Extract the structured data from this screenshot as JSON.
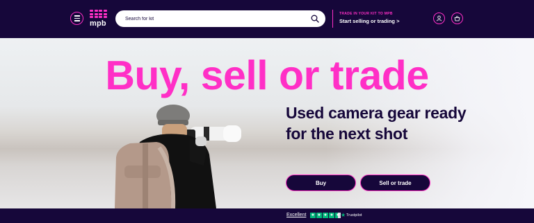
{
  "header": {
    "logo_text": "mpb",
    "search_placeholder": "Search for kit",
    "trade_eyebrow": "TRADE IN YOUR KIT TO MPB",
    "trade_link": "Start selling or trading >"
  },
  "hero": {
    "headline": "Buy, sell or trade",
    "subheadline": "Used camera gear ready for the next shot",
    "buttons": {
      "buy": "Buy",
      "sell": "Sell or trade"
    }
  },
  "trust": {
    "rating_label": "Excellent",
    "stars": 4.5,
    "brand": "Trustpilot"
  },
  "colors": {
    "brand_navy": "#16073a",
    "brand_pink": "#ff2fc6",
    "trustpilot_green": "#00b67a"
  },
  "icons": [
    "menu-icon",
    "search-icon",
    "account-icon",
    "basket-icon",
    "star-icon"
  ]
}
